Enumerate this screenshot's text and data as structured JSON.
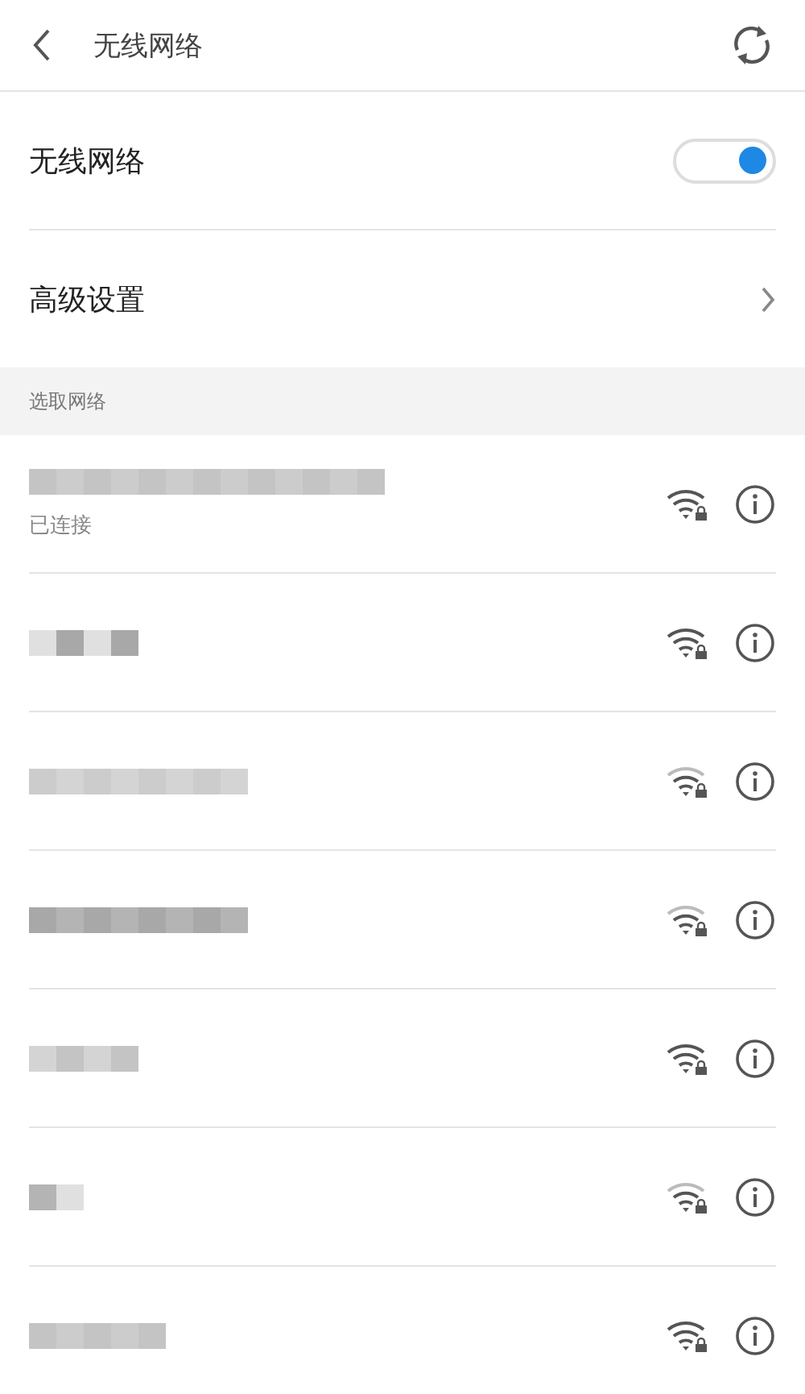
{
  "header": {
    "title": "无线网络"
  },
  "wifi_toggle": {
    "label": "无线网络",
    "on": true
  },
  "advanced": {
    "label": "高级设置"
  },
  "section_title": "选取网络",
  "networks": [
    {
      "status": "已连接",
      "weak_signal": false
    },
    {
      "weak_signal": false
    },
    {
      "weak_signal": true
    },
    {
      "weak_signal": true
    },
    {
      "weak_signal": false
    },
    {
      "weak_signal": true
    },
    {
      "weak_signal": false
    }
  ]
}
